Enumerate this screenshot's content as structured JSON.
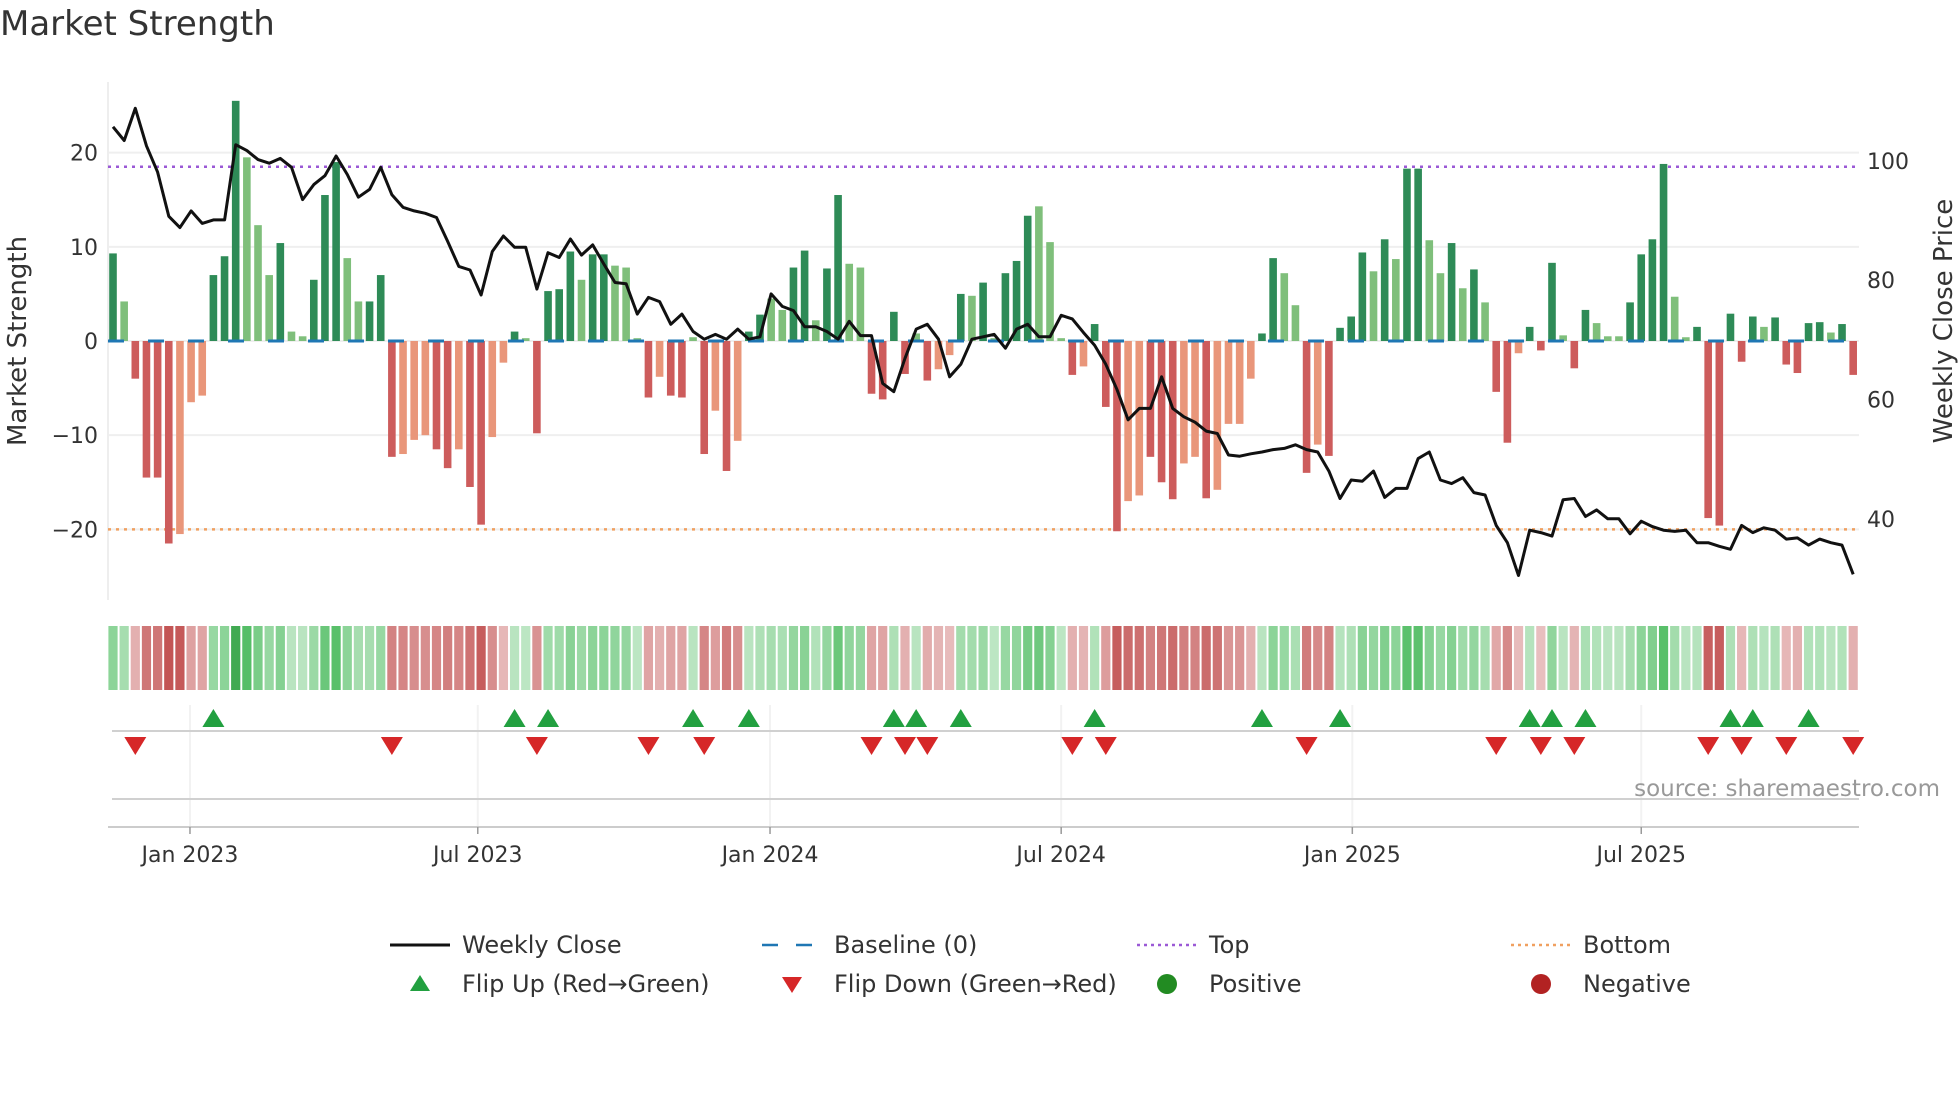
{
  "title": "Market Strength",
  "chart_data": {
    "type": "bar",
    "title": "Market Strength",
    "ylabel": "Market Strength",
    "y2label": "Weekly Close Price",
    "ylim": [
      -27.5,
      27.5
    ],
    "y2lim": [
      26.4,
      113.2
    ],
    "yticks": [
      -20,
      -10,
      0,
      10,
      20
    ],
    "ytick_labels": [
      "−20",
      "−10",
      "0",
      "10",
      "20"
    ],
    "y2ticks": [
      40,
      60,
      80,
      100
    ],
    "y2tick_labels": [
      "40",
      "60",
      "80",
      "100"
    ],
    "xticks": [
      {
        "week": 6.9,
        "label": "Jan 2023"
      },
      {
        "week": 32.7,
        "label": "Jul 2023"
      },
      {
        "week": 58.9,
        "label": "Jan 2024"
      },
      {
        "week": 85.0,
        "label": "Jul 2024"
      },
      {
        "week": 111.1,
        "label": "Jan 2025"
      },
      {
        "week": 137.0,
        "label": "Jul 2025"
      }
    ],
    "top_level": 18.5,
    "bottom_level": -20,
    "strength": [
      9.3,
      4.2,
      -4,
      -14.5,
      -14.5,
      -21.5,
      -20.5,
      -6.5,
      -5.8,
      7,
      9,
      25.5,
      19.5,
      12.3,
      7,
      10.4,
      1,
      0.5,
      6.5,
      15.5,
      19,
      8.8,
      4.2,
      4.2,
      7,
      -12.3,
      -12,
      -10.5,
      -10,
      -11.5,
      -13.5,
      -11.5,
      -15.5,
      -19.5,
      -10.2,
      -2.3,
      1,
      0.3,
      -9.8,
      5.3,
      5.5,
      9.5,
      6.5,
      9.2,
      9.2,
      8,
      7.8,
      0.3,
      -6,
      -3.8,
      -5.8,
      -6,
      0.4,
      -12,
      -7.4,
      -13.8,
      -10.6,
      1,
      2.8,
      4.5,
      3.3,
      7.8,
      9.6,
      2.2,
      7.7,
      15.5,
      8.2,
      7.8,
      -5.6,
      -6.2,
      3.1,
      -3.5,
      0.8,
      -4.2,
      -3,
      -1.5,
      5,
      4.8,
      6.2,
      0.3,
      7.2,
      8.5,
      13.3,
      14.3,
      10.5,
      0.3,
      -3.6,
      -2.7,
      1.8,
      -7,
      -20.2,
      -17,
      -16.4,
      -12.3,
      -15,
      -16.8,
      -13,
      -12.3,
      -16.7,
      -15.8,
      -8.8,
      -8.8,
      -4,
      0.8,
      8.8,
      7.2,
      3.8,
      -14,
      -11,
      -12.2,
      1.4,
      2.6,
      9.4,
      7.4,
      10.8,
      8.7,
      18.3,
      18.3,
      10.7,
      7.2,
      10.4,
      5.6,
      7.6,
      4.1,
      -5.4,
      -10.8,
      -1.3,
      1.5,
      -1,
      8.3,
      0.6,
      -2.9,
      3.3,
      1.9,
      0.5,
      0.5,
      4.1,
      9.2,
      10.8,
      18.8,
      4.7,
      0.4,
      1.5,
      -18.8,
      -19.6,
      2.9,
      -2.2,
      2.6,
      1.5,
      2.5,
      -2.5,
      -3.4,
      1.9,
      2,
      0.9,
      1.8,
      -3.6
    ],
    "shade": "GgRRRRrrrGGGgggGggGGGggGGRrrrRRrRRrrGgRGGGgGGggg R r RRgRrRrGGggGGgGGggRRGRgRrrGgGgGGGgggRrGRRrrRRRrrRrrrrGGggRrRGGGgGgGGggGgGgRRrGRGgRGgggGGGGggGRRGRGgGRRGGgGR",
    "weekly_close": [
      105.7,
      103.4,
      108.8,
      102.5,
      98.1,
      90.7,
      88.8,
      91.6,
      89.5,
      90.1,
      90.1,
      102.7,
      101.7,
      100.2,
      99.6,
      100.4,
      98.9,
      93.5,
      96,
      97.5,
      100.8,
      97.7,
      93.9,
      95.2,
      98.9,
      94.3,
      92.2,
      91.6,
      91.2,
      90.5,
      86.5,
      82.3,
      81.7,
      77.5,
      84.8,
      87.4,
      85.5,
      85.5,
      78.5,
      84.6,
      83.8,
      86.9,
      84.2,
      85.9,
      82.7,
      79.6,
      79.4,
      74.3,
      77.1,
      76.4,
      72.6,
      74.3,
      71.4,
      70.1,
      70.9,
      70.1,
      71.8,
      70.1,
      70.5,
      77.7,
      75.6,
      74.9,
      72.2,
      72.2,
      71.4,
      70.1,
      73.1,
      70.7,
      70.7,
      62.7,
      61.3,
      66.9,
      71.8,
      72.6,
      70.1,
      63.8,
      65.9,
      70.1,
      70.5,
      70.9,
      68.6,
      71.8,
      72.6,
      70.5,
      70.5,
      74.1,
      73.5,
      71.2,
      69.1,
      65.9,
      61.7,
      56.6,
      58.5,
      58.5,
      63.8,
      58.5,
      57.1,
      56.2,
      54.7,
      54.3,
      50.7,
      50.5,
      50.9,
      51.2,
      51.6,
      51.8,
      52.4,
      51.6,
      51.2,
      48,
      43.4,
      46.5,
      46.3,
      48,
      43.6,
      45.1,
      45.1,
      50.1,
      51.2,
      46.5,
      45.9,
      46.9,
      44.4,
      44,
      38.9,
      36,
      30.5,
      38.1,
      37.7,
      37.1,
      43.2,
      43.4,
      40.4,
      41.5,
      40,
      40,
      37.5,
      39.6,
      38.7,
      38.1,
      37.9,
      38.1,
      36,
      36,
      35.4,
      34.9,
      38.9,
      37.7,
      38.5,
      38.1,
      36.6,
      36.8,
      35.6,
      36.6,
      36,
      35.6,
      30.7
    ],
    "flip_up_weeks": [
      9,
      36,
      39,
      52,
      57,
      70,
      72,
      76,
      88,
      103,
      110,
      127,
      129,
      132,
      145,
      147,
      152
    ],
    "flip_down_weeks": [
      2,
      25,
      38,
      48,
      53,
      68,
      71,
      73,
      86,
      89,
      107,
      124,
      128,
      131,
      143,
      146,
      150,
      156
    ],
    "legend": [
      {
        "label": "Weekly Close",
        "kind": "line"
      },
      {
        "label": "Baseline (0)",
        "kind": "dash"
      },
      {
        "label": "Top",
        "kind": "dot-purple"
      },
      {
        "label": "Bottom",
        "kind": "dot-orange"
      },
      {
        "label": "Flip Up (Red→Green)",
        "kind": "tri-up"
      },
      {
        "label": "Flip Down (Green→Red)",
        "kind": "tri-down"
      },
      {
        "label": "Positive",
        "kind": "circle-green"
      },
      {
        "label": "Negative",
        "kind": "circle-red"
      }
    ],
    "legend_position": "bottom",
    "source": "source: sharemaestro.com",
    "colors": {
      "strong_pos": "#2e8b57",
      "weak_pos": "#7fbf7b",
      "strong_neg": "#cd5c5c",
      "weak_neg": "#e9967a",
      "baseline": "#1f77b4",
      "top": "#9b59d6",
      "bottom": "#f0a060",
      "line": "#111111",
      "flip_up": "#22a040",
      "flip_down": "#d62728",
      "positive": "#228b22",
      "negative": "#b22222"
    }
  }
}
